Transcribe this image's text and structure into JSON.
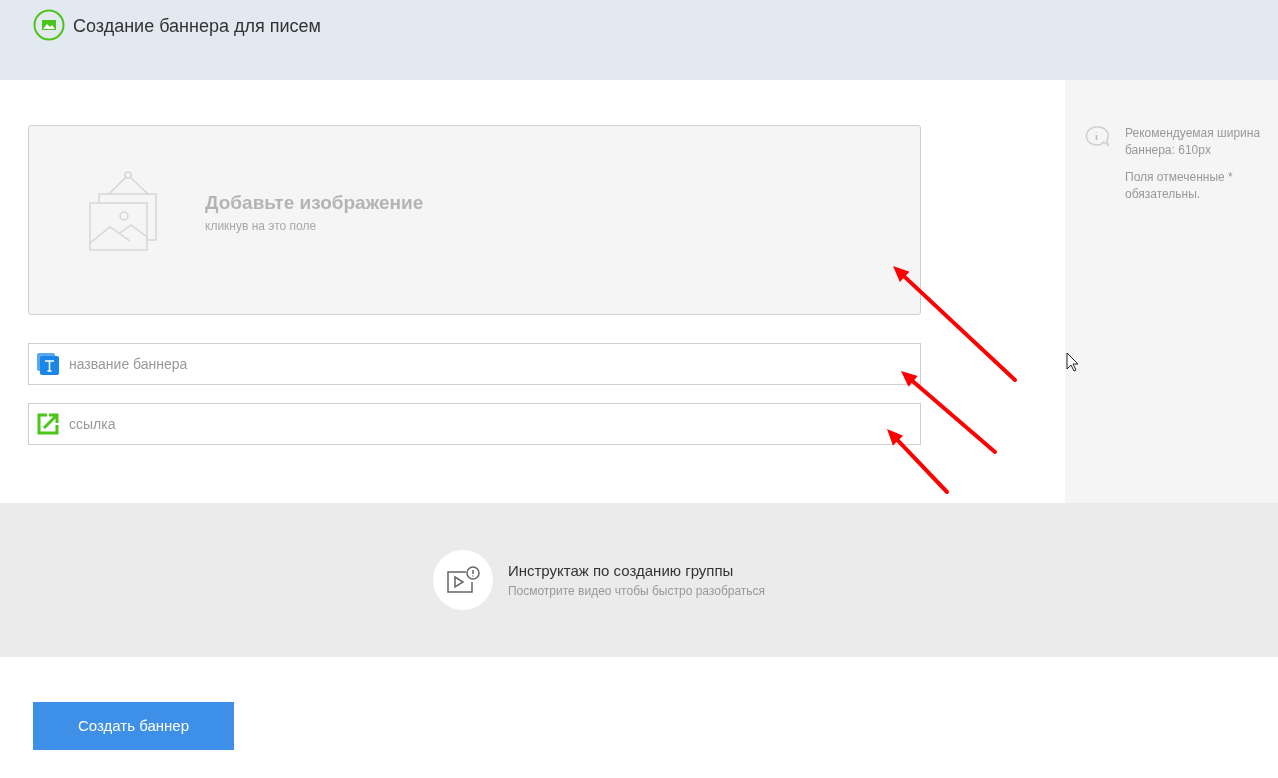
{
  "header": {
    "title": "Создание баннера для писем"
  },
  "upload": {
    "title": "Добавьте изображение",
    "hint": "кликнув на это поле"
  },
  "fields": [
    {
      "kind": "text",
      "placeholder": "название баннера"
    },
    {
      "kind": "link",
      "placeholder": "ссылка"
    }
  ],
  "sidebar": {
    "notes": [
      "Рекомендуемая ширина баннера: 610px",
      "Поля отмеченные * обязательны."
    ]
  },
  "tutorial": {
    "title": "Инструктаж по созданию группы",
    "subtitle": "Посмотрите видео чтобы быстро разобраться"
  },
  "submit_button": "Создать баннер"
}
